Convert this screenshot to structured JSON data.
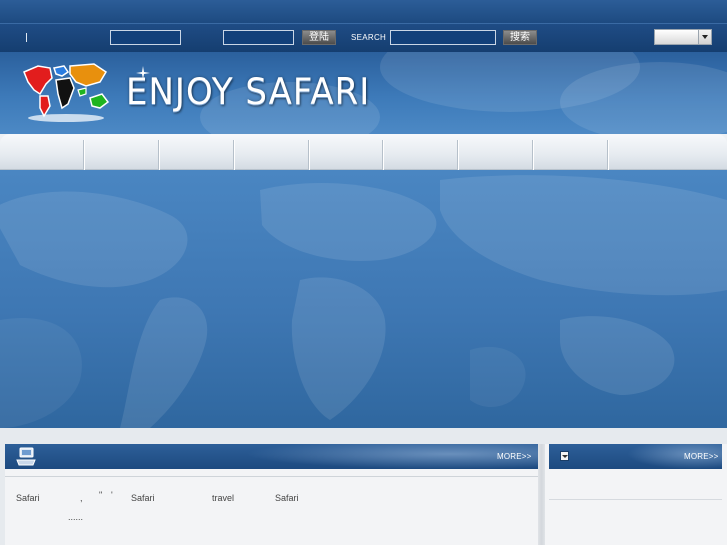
{
  "topbar": {
    "username_value": "",
    "password_value": "",
    "login_label": "登陆",
    "search_label": "SEARCH",
    "search_value": "",
    "search_button_label": "搜索",
    "language_selected": ""
  },
  "header": {
    "site_title": "ENJOY  SAFARI"
  },
  "nav": {
    "items": [
      "",
      "",
      "",
      "",
      "",
      "",
      "",
      "",
      ""
    ]
  },
  "main_panel": {
    "more_label": "MORE>>",
    "text_tokens": [
      "Safari",
      ",",
      "\"",
      "'",
      "Safari",
      "travel",
      "Safari"
    ],
    "ellipsis": "......"
  },
  "side_panel": {
    "more_label": "MORE>>"
  },
  "icons": {
    "main_panel_icon": "computer-icon",
    "side_panel_icon": "download-icon",
    "logo": "world-map-logo"
  },
  "colors": {
    "header_blue": "#1d4a80",
    "hero_blue": "#3e77b3",
    "panel_bg": "#f3f4f6"
  }
}
